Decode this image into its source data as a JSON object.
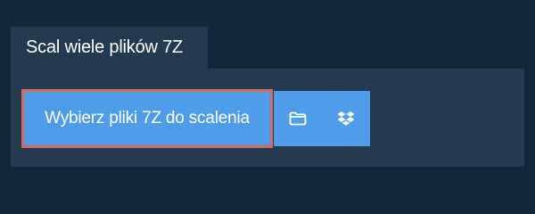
{
  "colors": {
    "page_background": "#13263a",
    "tab_background": "#233a50",
    "panel_background": "#233a50",
    "button_background": "#4f9ce9",
    "button_border": "#d46a62",
    "text": "#ffffff"
  },
  "tab": {
    "label": "Scal wiele plików 7Z"
  },
  "toolbar": {
    "primary_label": "Wybierz pliki 7Z do scalenia",
    "folder_icon": "folder-icon",
    "dropbox_icon": "dropbox-icon"
  }
}
